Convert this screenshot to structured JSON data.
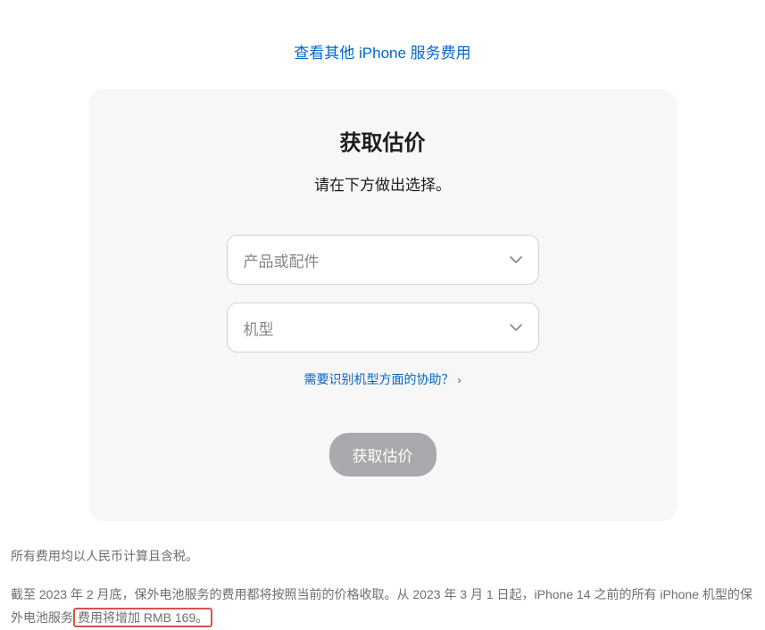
{
  "topLink": {
    "label": "查看其他 iPhone 服务费用"
  },
  "card": {
    "title": "获取估价",
    "subtitle": "请在下方做出选择。",
    "selectProduct": {
      "placeholder": "产品或配件"
    },
    "selectModel": {
      "placeholder": "机型"
    },
    "helpLink": {
      "label": "需要识别机型方面的协助？"
    },
    "submit": {
      "label": "获取估价"
    }
  },
  "footer": {
    "note1": "所有费用均以人民币计算且含税。",
    "note2_prefix": "截至 2023 年 2 月底，保外电池服务的费用都将按照当前的价格收取。从 2023 年 3 月 1 日起，iPhone 14 之前的所有 iPhone 机型的保外电池服务",
    "note2_highlight": "费用将增加 RMB 169。"
  }
}
